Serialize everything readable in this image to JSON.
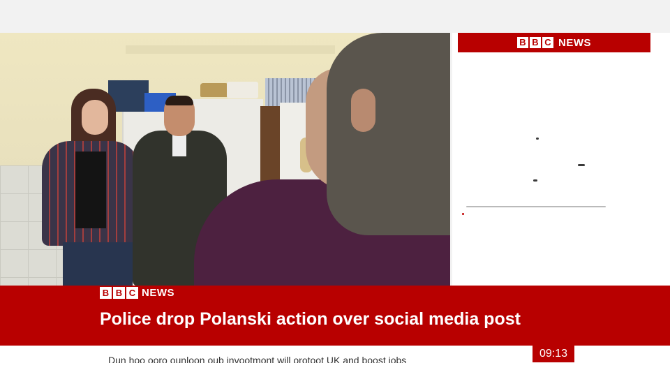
{
  "side_panel": {
    "brand_letters": [
      "B",
      "B",
      "C"
    ],
    "brand_word": "NEWS"
  },
  "lower_third": {
    "brand_letters": [
      "B",
      "B",
      "C"
    ],
    "brand_word": "NEWS",
    "headline": "Police drop Polanski action over social media post",
    "ticker_text": "Dun hoo ooro ounloon oub invootmont will orotoot UK and boost jobs",
    "clock": "09:13"
  },
  "colors": {
    "bbc_red": "#b80000",
    "text_on_red": "#ffffff"
  }
}
